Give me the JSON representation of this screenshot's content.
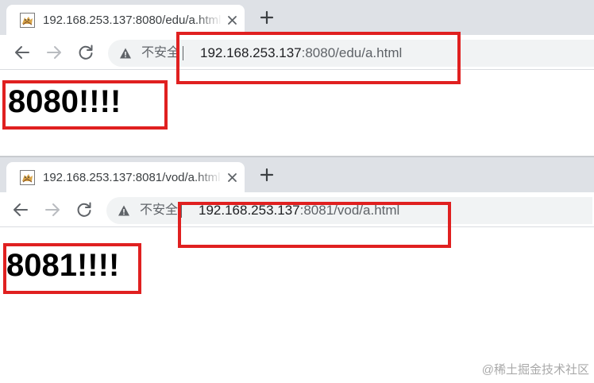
{
  "colors": {
    "tabstrip_bg": "#dee1e6",
    "omnibox_bg": "#f1f3f4",
    "annotation_red": "#e02020",
    "icon_gray": "#5f6368"
  },
  "windows": [
    {
      "tab": {
        "title": "192.168.253.137:8080/edu/a.html",
        "favicon": "tomcat-favicon-icon",
        "close_icon": "close-icon"
      },
      "new_tab_icon": "plus-icon",
      "nav": {
        "back_icon": "arrow-left-icon",
        "forward_icon": "arrow-right-icon",
        "reload_icon": "reload-icon"
      },
      "omnibox": {
        "warning_icon": "warning-triangle-icon",
        "security_label": "不安全",
        "url_host": "192.168.253.137",
        "url_rest": ":8080/edu/a.html"
      },
      "page": {
        "heading": "8080!!!!"
      }
    },
    {
      "tab": {
        "title": "192.168.253.137:8081/vod/a.html",
        "favicon": "tomcat-favicon-icon",
        "close_icon": "close-icon"
      },
      "new_tab_icon": "plus-icon",
      "nav": {
        "back_icon": "arrow-left-icon",
        "forward_icon": "arrow-right-icon",
        "reload_icon": "reload-icon"
      },
      "omnibox": {
        "warning_icon": "warning-triangle-icon",
        "security_label": "不安全",
        "url_host": "192.168.253.137",
        "url_rest": ":8081/vod/a.html"
      },
      "page": {
        "heading": "8081!!!!"
      }
    }
  ],
  "watermark": "@稀土掘金技术社区"
}
